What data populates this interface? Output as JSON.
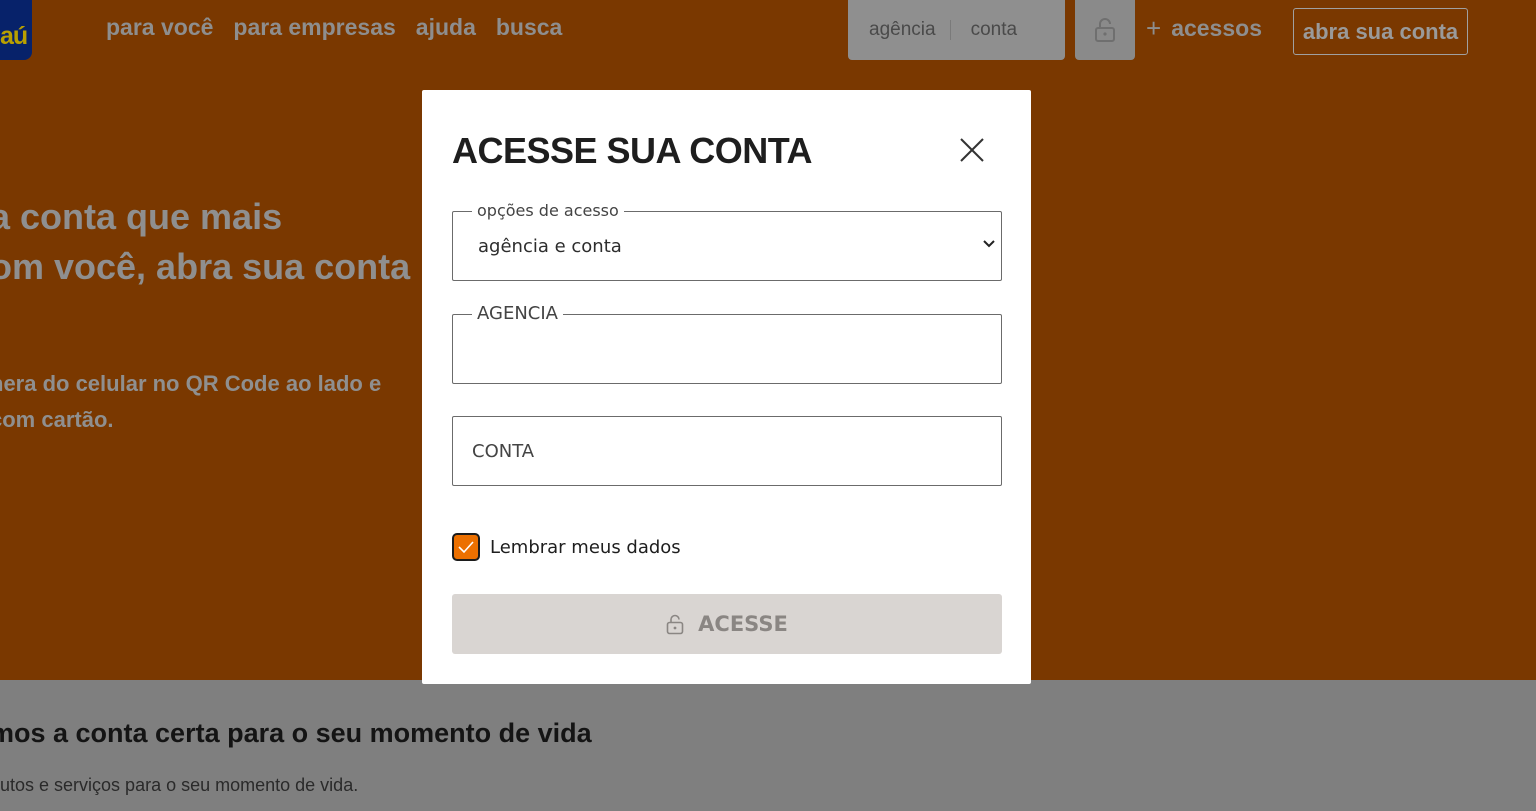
{
  "header": {
    "logo_text": "aú",
    "nav": [
      "para você",
      "para empresas",
      "ajuda",
      "busca"
    ],
    "login_box": {
      "agencia_placeholder": "agência",
      "conta_placeholder": "conta"
    },
    "acessos_plus": "+",
    "acessos_label": "acessos",
    "abra_conta_label": "abra sua conta"
  },
  "hero": {
    "title_line1": "a conta que mais",
    "title_line2": "om você, abra sua conta",
    "sub_line1": "nera do celular no QR Code ao lado e",
    "sub_line2": "com cartão."
  },
  "lower_section": {
    "title": "mos a conta certa para o seu momento de vida",
    "subtitle": "dutos e serviços para o seu momento de vida."
  },
  "modal": {
    "title": "ACESSE SUA CONTA",
    "access_options": {
      "legend": "opções de acesso",
      "selected": "agência e conta"
    },
    "agencia": {
      "legend": "AGENCIA",
      "value": ""
    },
    "conta": {
      "placeholder": "CONTA",
      "value": ""
    },
    "remember": {
      "label": "Lembrar meus dados",
      "checked": true
    },
    "submit_label": "ACESSE"
  },
  "colors": {
    "brand_orange": "#ec7000",
    "overlay_orange": "#7a3800",
    "button_disabled": "#d9d5d2"
  }
}
